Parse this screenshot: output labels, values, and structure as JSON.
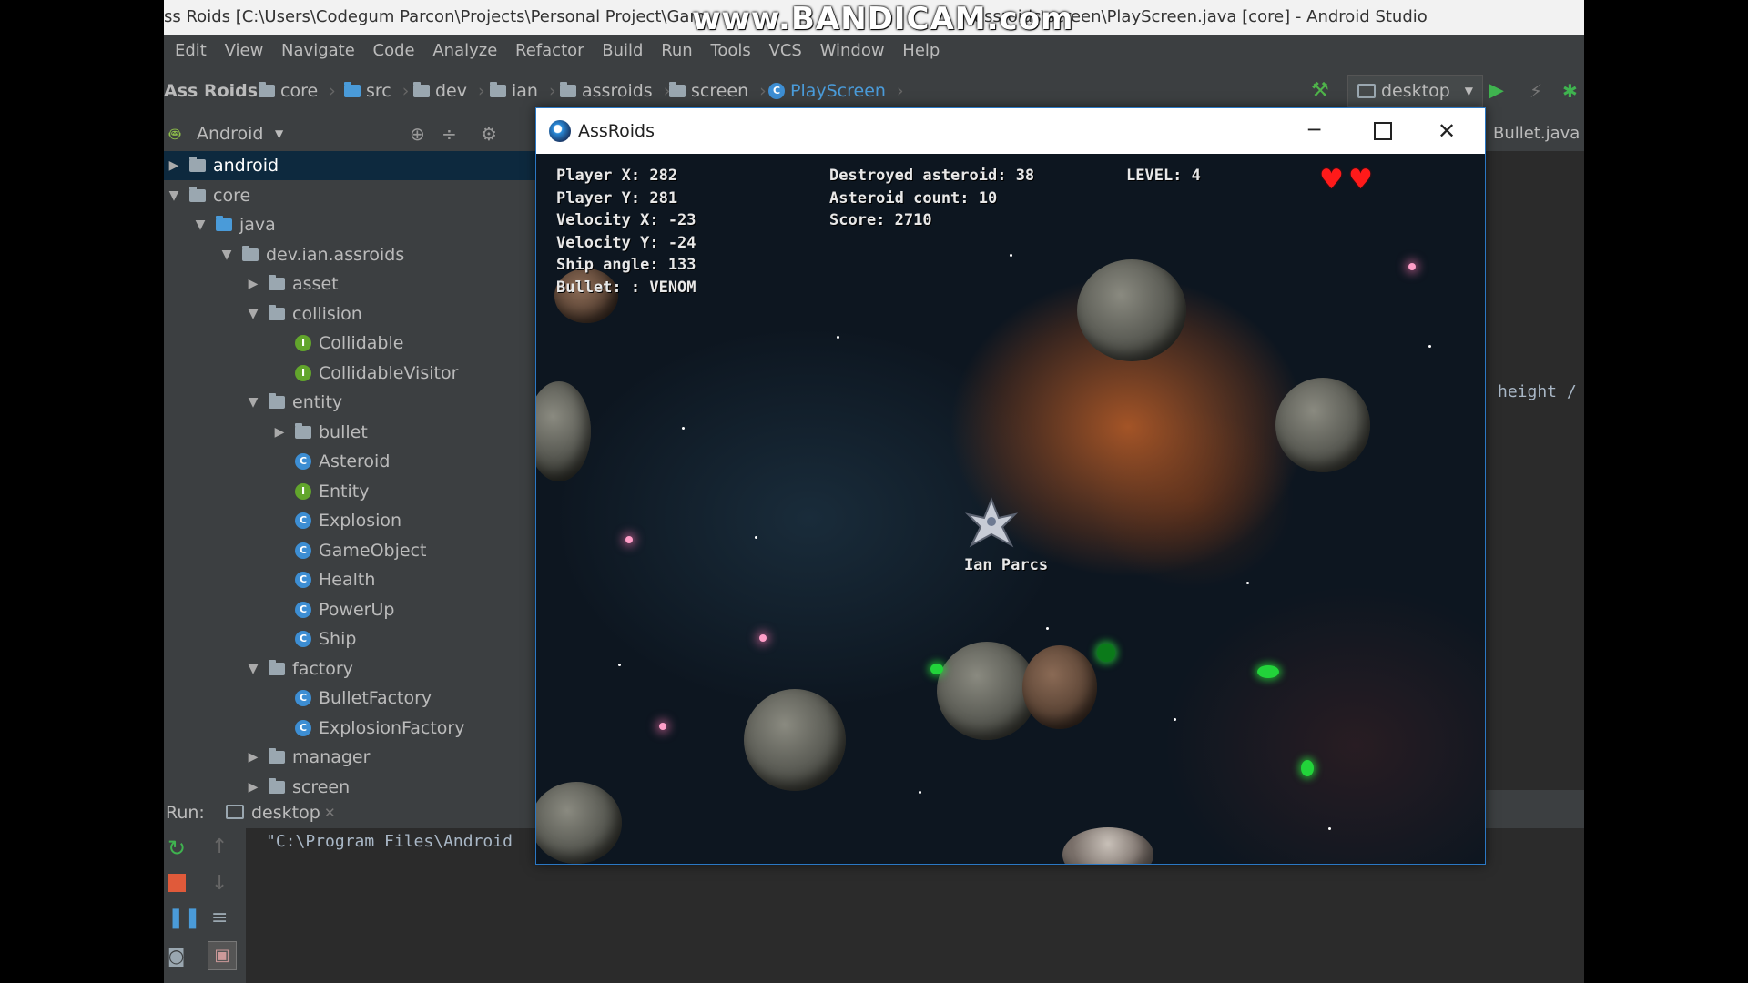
{
  "window": {
    "title": "ss Roids [C:\\Users\\Codegum Parcon\\Projects\\Personal Project\\Gam",
    "title_tail": "assroids\\screen\\PlayScreen.java [core] - Android Studio",
    "watermark": "www.BANDICAM.com"
  },
  "menu": [
    "Edit",
    "View",
    "Navigate",
    "Code",
    "Analyze",
    "Refactor",
    "Build",
    "Run",
    "Tools",
    "VCS",
    "Window",
    "Help"
  ],
  "navbar": {
    "project": "Ass Roids",
    "crumbs": [
      "core",
      "src",
      "dev",
      "ian",
      "assroids",
      "screen"
    ],
    "file": "PlayScreen",
    "run_config": "desktop"
  },
  "project_panel": {
    "view": "Android",
    "tree": [
      {
        "label": "android",
        "type": "module",
        "expanded": false,
        "selected": true
      },
      {
        "label": "core",
        "type": "module",
        "expanded": true
      },
      {
        "label": "java",
        "type": "folder",
        "expanded": true
      },
      {
        "label": "dev.ian.assroids",
        "type": "package",
        "expanded": true
      },
      {
        "label": "asset",
        "type": "package",
        "expanded": false
      },
      {
        "label": "collision",
        "type": "package",
        "expanded": true
      },
      {
        "label": "Collidable",
        "type": "interface"
      },
      {
        "label": "CollidableVisitor",
        "type": "interface"
      },
      {
        "label": "entity",
        "type": "package",
        "expanded": true
      },
      {
        "label": "bullet",
        "type": "package",
        "expanded": false
      },
      {
        "label": "Asteroid",
        "type": "class"
      },
      {
        "label": "Entity",
        "type": "interface"
      },
      {
        "label": "Explosion",
        "type": "class"
      },
      {
        "label": "GameObject",
        "type": "class"
      },
      {
        "label": "Health",
        "type": "class"
      },
      {
        "label": "PowerUp",
        "type": "class"
      },
      {
        "label": "Ship",
        "type": "class"
      },
      {
        "label": "factory",
        "type": "package",
        "expanded": true
      },
      {
        "label": "BulletFactory",
        "type": "class"
      },
      {
        "label": "ExplosionFactory",
        "type": "class"
      },
      {
        "label": "manager",
        "type": "package",
        "expanded": false
      },
      {
        "label": "screen",
        "type": "package",
        "expanded": false
      }
    ]
  },
  "editor": {
    "tab": "Bullet.java",
    "code_fragment": "height /"
  },
  "run_panel": {
    "label": "Run:",
    "tab": "desktop",
    "command": "\"C:\\Program Files\\Android"
  },
  "game": {
    "title": "AssRoids",
    "hud_left": [
      "Player X: 282",
      "Player Y: 281",
      "Velocity X: -23",
      "Velocity Y: -24",
      "Ship angle: 133",
      "Bullet: : VENOM"
    ],
    "hud_center": [
      "Destroyed asteroid: 38",
      "Asteroid count: 10",
      "Score: 2710"
    ],
    "level": "LEVEL: 4",
    "lives": 2,
    "player_name": "Ian Parcs"
  },
  "colors": {
    "ide_bg": "#3c3f41",
    "editor_bg": "#2b2b2b",
    "selection": "#0d293e",
    "class_icon": "#3d8ed3",
    "interface_icon": "#62a52c",
    "run_green": "#3fb34f"
  }
}
